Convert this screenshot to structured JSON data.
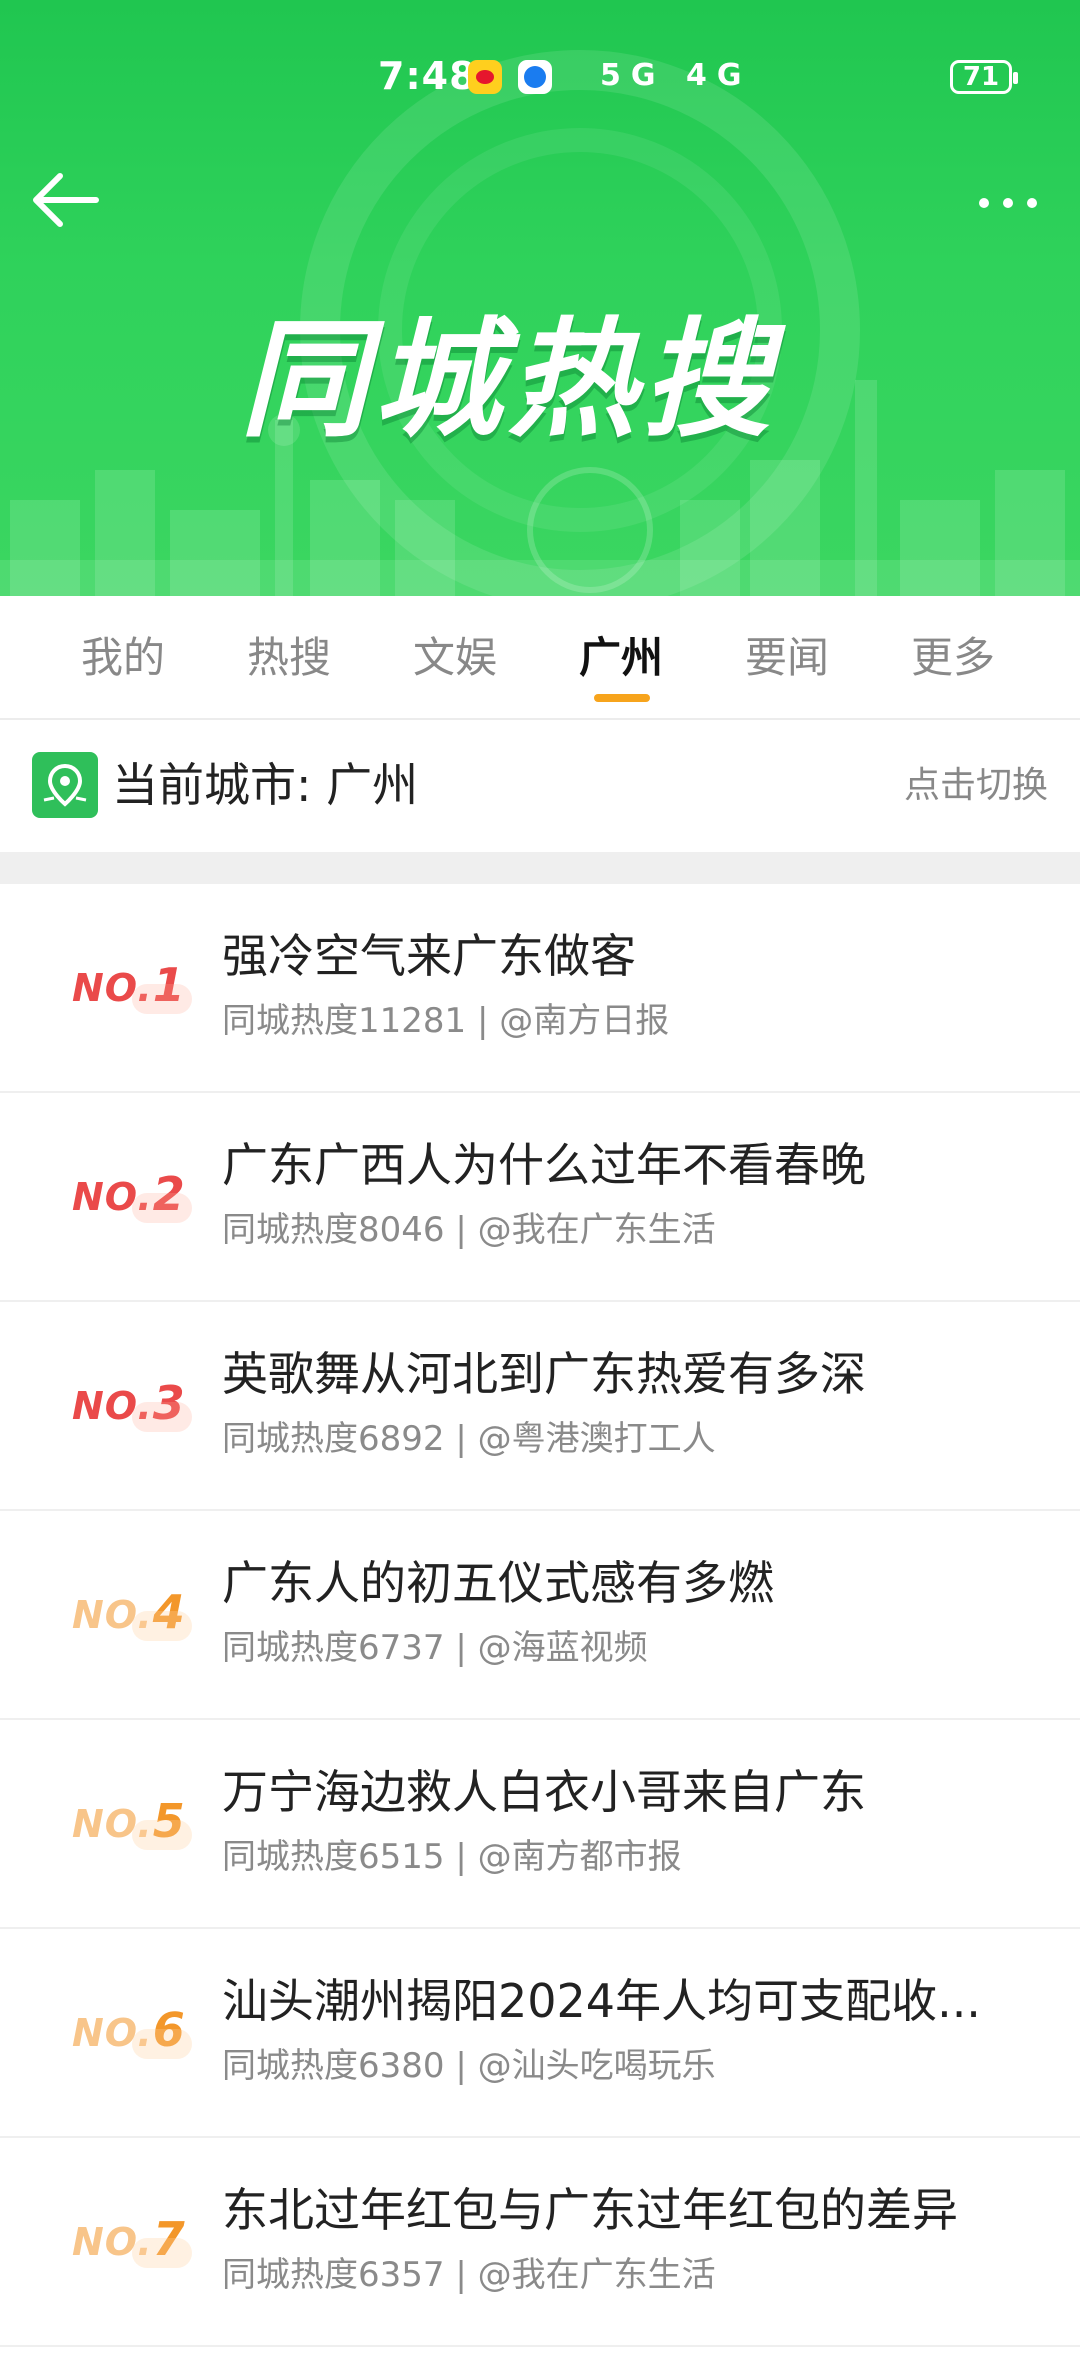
{
  "status_bar": {
    "time": "7:48",
    "network_text": "5G 4G",
    "battery": "71"
  },
  "header": {
    "title": "同城热搜",
    "back_icon": "arrow-left-icon",
    "more_icon": "more-dots-icon",
    "banner_color": "#2fd25b"
  },
  "tabs": [
    {
      "label": "我的",
      "active": false
    },
    {
      "label": "热搜",
      "active": false
    },
    {
      "label": "文娱",
      "active": false
    },
    {
      "label": "广州",
      "active": true
    },
    {
      "label": "要闻",
      "active": false
    },
    {
      "label": "更多",
      "active": false
    }
  ],
  "city": {
    "label": "当前城市: 广州",
    "switch_label": "点击切换",
    "icon": "location-map-icon"
  },
  "list": [
    {
      "rank_prefix": "NO.",
      "rank": "1",
      "title": "强冷空气来广东做客",
      "meta": "同城热度11281 | @南方日报",
      "tier": "hot"
    },
    {
      "rank_prefix": "NO.",
      "rank": "2",
      "title": "广东广西人为什么过年不看春晚",
      "meta": "同城热度8046 | @我在广东生活",
      "tier": "hot"
    },
    {
      "rank_prefix": "NO.",
      "rank": "3",
      "title": "英歌舞从河北到广东热爱有多深",
      "meta": "同城热度6892 | @粤港澳打工人",
      "tier": "hot"
    },
    {
      "rank_prefix": "NO.",
      "rank": "4",
      "title": "广东人的初五仪式感有多燃",
      "meta": "同城热度6737 | @海蓝视频",
      "tier": "warm"
    },
    {
      "rank_prefix": "NO.",
      "rank": "5",
      "title": "万宁海边救人白衣小哥来自广东",
      "meta": "同城热度6515 | @南方都市报",
      "tier": "warm"
    },
    {
      "rank_prefix": "NO.",
      "rank": "6",
      "title": "汕头潮州揭阳2024年人均可支配收...",
      "meta": "同城热度6380 | @汕头吃喝玩乐",
      "tier": "warm"
    },
    {
      "rank_prefix": "NO.",
      "rank": "7",
      "title": "东北过年红包与广东过年红包的差异",
      "meta": "同城热度6357 | @我在广东生活",
      "tier": "warm"
    }
  ],
  "colors": {
    "accent_tab_underline": "#f7a41c",
    "rank_hot": "#ea4a4a",
    "rank_warm": "#f3972a",
    "city_icon_bg": "#2fbf5a"
  }
}
